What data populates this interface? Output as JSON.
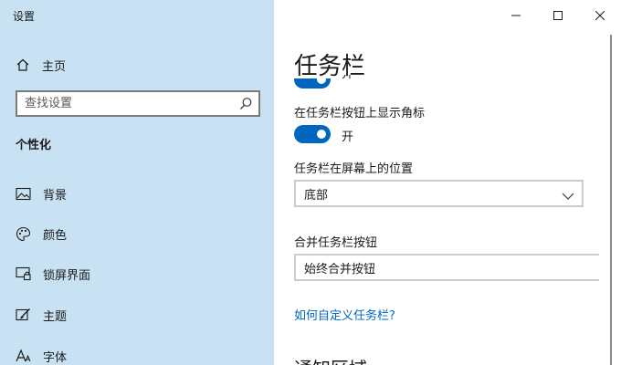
{
  "window": {
    "title": "设置"
  },
  "sidebar": {
    "home": {
      "label": "主页",
      "icon": "home-icon"
    },
    "search": {
      "placeholder": "查找设置",
      "icon": "search-icon"
    },
    "section_heading": "个性化",
    "items": [
      {
        "label": "背景",
        "icon": "picture-icon"
      },
      {
        "label": "颜色",
        "icon": "palette-icon"
      },
      {
        "label": "锁屏界面",
        "icon": "lock-screen-icon"
      },
      {
        "label": "主题",
        "icon": "brush-icon"
      },
      {
        "label": "字体",
        "icon": "font-icon"
      }
    ]
  },
  "content": {
    "page_title": "任务栏",
    "partial_toggle_state": "开",
    "corner_badges": {
      "label": "在任务栏按钮上显示角标",
      "state": "开",
      "on": true
    },
    "position": {
      "label": "任务栏在屏幕上的位置",
      "selected": "底部"
    },
    "combine": {
      "label": "合并任务栏按钮",
      "selected": "始终合并按钮"
    },
    "help_link": "如何自定义任务栏?",
    "next_section": "通知区域"
  },
  "colors": {
    "sidebar_bg": "#c8e2f3",
    "accent": "#0067c0"
  }
}
